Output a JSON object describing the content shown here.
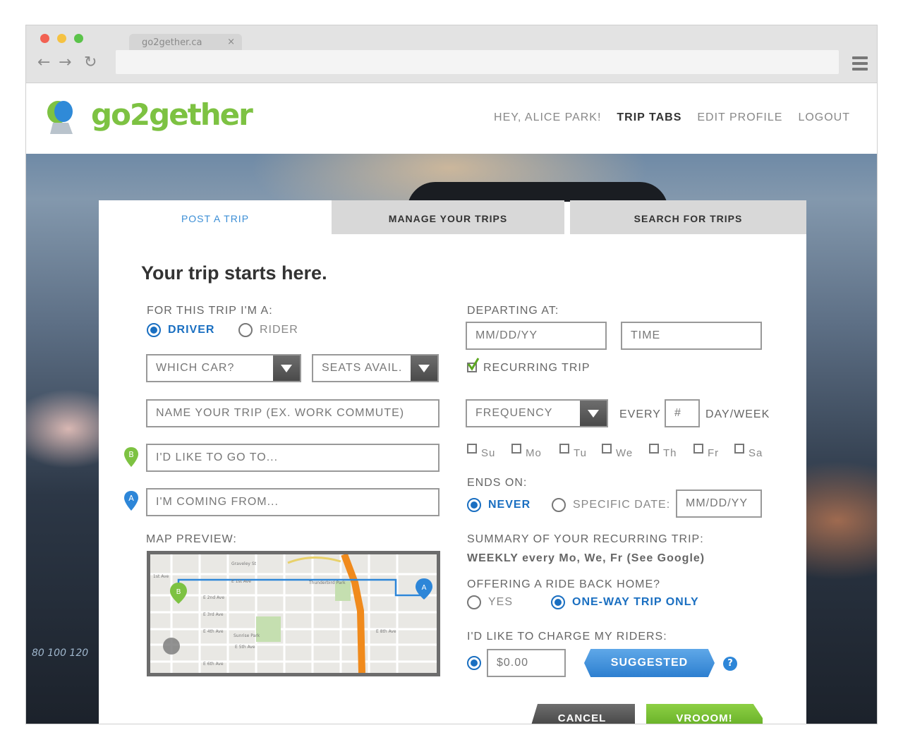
{
  "browser": {
    "tab_title": "go2gether.ca",
    "tab_close": "×",
    "back": "←",
    "forward": "→",
    "reload": "↻"
  },
  "header": {
    "logo_text": "go2gether",
    "nav": {
      "greeting": "HEY, ALICE PARK!",
      "trip_tabs": "TRIP TABS",
      "edit_profile": "EDIT PROFILE",
      "logout": "LOGOUT"
    }
  },
  "tabs": {
    "post": "POST A TRIP",
    "manage": "MANAGE YOUR TRIPS",
    "search": "SEARCH FOR TRIPS"
  },
  "form": {
    "heading": "Your trip starts here.",
    "role_label": "FOR THIS TRIP I'M A:",
    "driver": "DRIVER",
    "rider": "RIDER",
    "which_car": "WHICH CAR?",
    "seats": "SEATS AVAIL.",
    "trip_name": "NAME YOUR TRIP (EX. WORK COMMUTE)",
    "destination": "I'D LIKE TO GO TO...",
    "origin": "I'M COMING FROM...",
    "map_label": "MAP PREVIEW:",
    "departing_label": "DEPARTING AT:",
    "date_placeholder": "MM/DD/YY",
    "time_placeholder": "TIME",
    "recurring": "RECURRING TRIP",
    "frequency": "FREQUENCY",
    "every": "EVERY",
    "every_value": "#",
    "day_week": "DAY/WEEK",
    "days": [
      "Su",
      "Mo",
      "Tu",
      "We",
      "Th",
      "Fr",
      "Sa"
    ],
    "ends_label": "ENDS ON:",
    "never": "NEVER",
    "specific_date": "SPECIFIC DATE:",
    "end_date": "MM/DD/YY",
    "summary_label": "SUMMARY OF YOUR RECURRING TRIP:",
    "summary_value": "WEEKLY every Mo, We, Fr (See Google)",
    "ride_back_label": "OFFERING A RIDE BACK HOME?",
    "yes": "YES",
    "one_way": "ONE-WAY TRIP ONLY",
    "charge_label": "I'D LIKE TO CHARGE MY RIDERS:",
    "charge_value": "$0.00",
    "suggested": "SUGGESTED",
    "help": "?",
    "cancel": "CANCEL",
    "vroom": "VROOOM!"
  },
  "map": {
    "pin_a": "A",
    "pin_b": "B",
    "streets": [
      "Graveley St",
      "1st Ave",
      "E 1st Ave",
      "E 2nd Ave",
      "E 3rd Ave",
      "E 4th Ave",
      "E 5th Ave",
      "E 6th Ave",
      "E 8th Ave",
      "Sunrise Park",
      "Thunderbird Park"
    ]
  },
  "colors": {
    "accent_blue": "#1a6fc1",
    "brand_green": "#7dc242",
    "route_orange": "#f08a1c"
  }
}
